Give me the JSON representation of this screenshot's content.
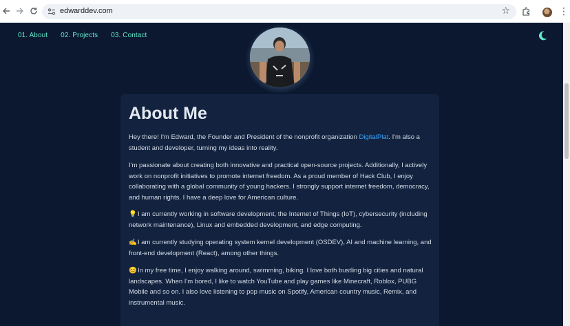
{
  "browser": {
    "url": "edwarddev.com"
  },
  "nav": {
    "items": [
      "01. About",
      "02. Projects",
      "03. Contact"
    ]
  },
  "about": {
    "title": "About Me",
    "p1_before": "Hey there! I'm Edward, the Founder and President of the nonprofit organization ",
    "p1_link": "DigitalPlat",
    "p1_after": ". I'm also a student and developer, turning my ideas into reality.",
    "p2": "I'm passionate about creating both innovative and practical open-source projects. Additionally, I actively work on nonprofit initiatives to promote internet freedom. As a proud member of Hack Club, I enjoy collaborating with a global community of young hackers. I strongly support internet freedom, democracy, and human rights. I have a deep love for American culture.",
    "p3": "I am currently working in software development, the Internet of Things (IoT), cybersecurity (including network maintenance), Linux and embedded development, and edge computing.",
    "p4": "I am currently studying operating system kernel development (OSDEV), AI and machine learning, and front-end development (React), among other things.",
    "p5": "In my free time, I enjoy walking around, swimming, biking. I love both bustling big cities and natural landscapes. When I'm bored, I like to watch YouTube and play games like Minecraft, Roblox, PUBG Mobile and so on. I also love listening to pop music on Spotify, American country music, Remix, and instrumental music."
  },
  "colors": {
    "background": "#0b1830",
    "card": "#13233f",
    "accent": "#63e6c8",
    "link": "#3aa4ff"
  },
  "icons": {
    "p3": "lightbulb-icon",
    "p4": "writing-hand-icon",
    "p5": "smiling-face-icon",
    "theme": "moon-icon"
  }
}
